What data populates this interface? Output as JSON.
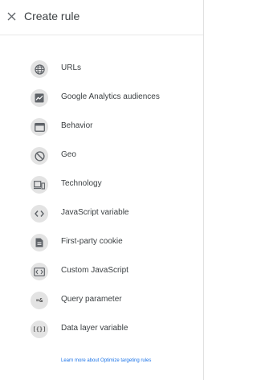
{
  "header": {
    "title": "Create rule",
    "close_icon": "close-icon"
  },
  "rules": [
    {
      "label": "URLs",
      "icon": "globe-icon"
    },
    {
      "label": "Google Analytics audiences",
      "icon": "analytics-chart-icon"
    },
    {
      "label": "Behavior",
      "icon": "browser-window-icon"
    },
    {
      "label": "Geo",
      "icon": "geo-compass-icon"
    },
    {
      "label": "Technology",
      "icon": "devices-icon"
    },
    {
      "label": "JavaScript variable",
      "icon": "code-brackets-icon"
    },
    {
      "label": "First-party cookie",
      "icon": "document-icon"
    },
    {
      "label": "Custom JavaScript",
      "icon": "custom-code-icon"
    },
    {
      "label": "Query parameter",
      "icon": "query-param-icon",
      "glyph": "=&"
    },
    {
      "label": "Data layer variable",
      "icon": "data-layer-icon",
      "glyph": "[{}]"
    }
  ],
  "footer": {
    "link_text": "Learn more about Optimize targeting rules"
  },
  "colors": {
    "icon_bg": "#e3e3e3",
    "icon_fg": "#5f6368",
    "link": "#1a73e8",
    "text": "#3c4043"
  }
}
